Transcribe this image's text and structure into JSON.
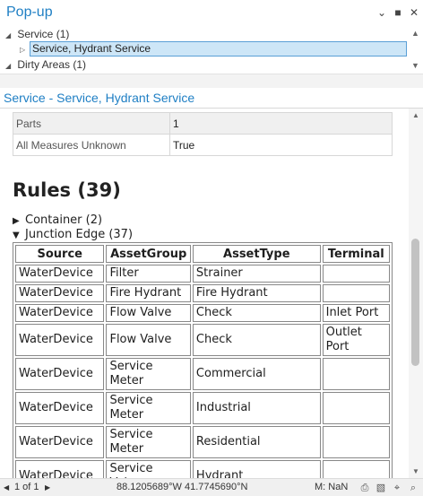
{
  "window": {
    "title": "Pop-up"
  },
  "tree": {
    "items": [
      {
        "label": "Service (1)"
      },
      {
        "label": "Service, Hydrant Service"
      },
      {
        "label": "Dirty Areas (1)"
      }
    ]
  },
  "section": {
    "title": "Service - Service, Hydrant Service"
  },
  "attributes": [
    {
      "key": "Parts",
      "value": "1"
    },
    {
      "key": "All Measures Unknown",
      "value": "True"
    }
  ],
  "rules": {
    "heading": "Rules (39)",
    "groups": [
      {
        "label": "Container (2)",
        "expanded": false
      },
      {
        "label": "Junction Edge (37)",
        "expanded": true
      }
    ],
    "columns": [
      "Source",
      "AssetGroup",
      "AssetType",
      "Terminal"
    ],
    "rows": [
      [
        "WaterDevice",
        "Filter",
        "Strainer",
        ""
      ],
      [
        "WaterDevice",
        "Fire Hydrant",
        "Fire Hydrant",
        ""
      ],
      [
        "WaterDevice",
        "Flow Valve",
        "Check",
        "Inlet Port"
      ],
      [
        "WaterDevice",
        "Flow Valve",
        "Check",
        "Outlet Port"
      ],
      [
        "WaterDevice",
        "Service Meter",
        "Commercial",
        ""
      ],
      [
        "WaterDevice",
        "Service Meter",
        "Industrial",
        ""
      ],
      [
        "WaterDevice",
        "Service Meter",
        "Residential",
        ""
      ],
      [
        "WaterDevice",
        "Service Valve",
        "Hydrant",
        ""
      ]
    ]
  },
  "status": {
    "page": "1 of 1",
    "coords": "88.1205689°W 41.7745690°N",
    "measure": "M: NaN"
  },
  "icons": [
    "chevron-down-icon",
    "maximize-icon",
    "close-icon",
    "print-icon",
    "export-icon",
    "locate-icon",
    "zoom-icon"
  ]
}
